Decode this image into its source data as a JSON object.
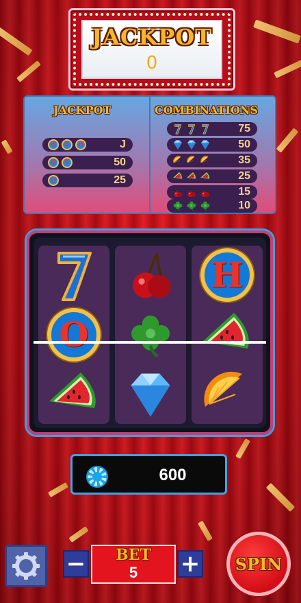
{
  "jackpot": {
    "title": "JACKPOT",
    "value": "0"
  },
  "paytable": {
    "left_header": "JACKPOT",
    "right_header": "COMBINATIONS",
    "jackpot_rows": [
      {
        "letters": [
          "O",
          "T",
          "H"
        ],
        "payout": "J"
      },
      {
        "letters": [
          "O",
          "T"
        ],
        "payout": "50"
      },
      {
        "letters": [
          "O"
        ],
        "payout": "25"
      }
    ],
    "combination_rows": [
      {
        "symbol": "seven",
        "payout": "75"
      },
      {
        "symbol": "diamond",
        "payout": "50"
      },
      {
        "symbol": "orange",
        "payout": "35"
      },
      {
        "symbol": "watermelon",
        "payout": "25"
      },
      {
        "symbol": "cherry",
        "payout": "15"
      },
      {
        "symbol": "clover",
        "payout": "10"
      }
    ]
  },
  "reels": [
    [
      "seven",
      "coin-O",
      "watermelon"
    ],
    [
      "cherry",
      "clover",
      "diamond"
    ],
    [
      "coin-H",
      "watermelon",
      "orange"
    ]
  ],
  "reel_letters": {
    "coin_O": "O",
    "coin_H": "H"
  },
  "balance": {
    "value": "600"
  },
  "bet": {
    "label": "BET",
    "value": "5",
    "minus": "−",
    "plus": "+"
  },
  "spin": {
    "label": "SPIN"
  },
  "icons": {
    "settings": "gear-icon",
    "balance": "chip-icon"
  },
  "colors": {
    "gold": "#f5b72a",
    "red": "#e3141e",
    "blue_border": "#3fa4e8",
    "reel_bg": "#4a2a58"
  }
}
